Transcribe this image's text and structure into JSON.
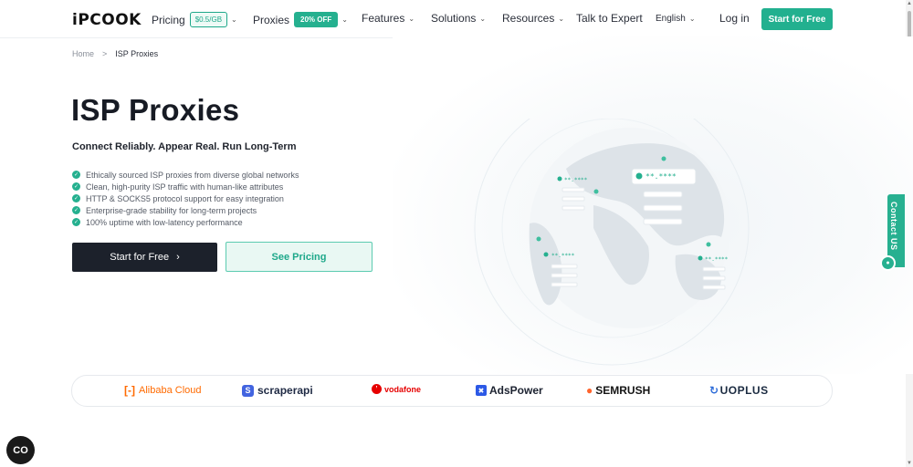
{
  "header": {
    "logo": "iPCOOK",
    "nav": {
      "pricing": {
        "label": "Pricing",
        "badge": "$0.5/GB"
      },
      "proxies": {
        "label": "Proxies",
        "badge": "20% OFF"
      },
      "features": {
        "label": "Features"
      },
      "solutions": {
        "label": "Solutions"
      },
      "resources": {
        "label": "Resources"
      },
      "talk_expert": {
        "label": "Talk to Expert"
      },
      "language": {
        "label": "English"
      }
    },
    "login_label": "Log in",
    "cta_label": "Start for Free"
  },
  "breadcrumb": {
    "home": "Home",
    "separator": ">",
    "current": "ISP Proxies"
  },
  "hero": {
    "title": "ISP Proxies",
    "subtitle": "Connect Reliably. Appear Real. Run Long-Term",
    "features": [
      "Ethically sourced ISP proxies from diverse global networks",
      "Clean, high-purity ISP traffic with human-like attributes",
      "HTTP & SOCKS5 protocol support for easy integration",
      "Enterprise-grade stability for long-term projects",
      "100% uptime with low-latency performance"
    ],
    "primary_button": "Start for Free",
    "secondary_button": "See Pricing"
  },
  "globe": {
    "ip_labels": [
      "**.****",
      "**.****",
      "**.****",
      "**.****"
    ]
  },
  "contact_tab": {
    "label": "Contact US"
  },
  "partners": {
    "alibaba": "Alibaba Cloud",
    "scraperapi": "scraperapi",
    "vodafone": "vodafone",
    "adspower": "AdsPower",
    "semrush": "SEMRUSH",
    "duoplus": "UOPLUS"
  },
  "colors": {
    "accent": "#22b08f",
    "dark": "#1c212b",
    "text": "#171b24"
  }
}
